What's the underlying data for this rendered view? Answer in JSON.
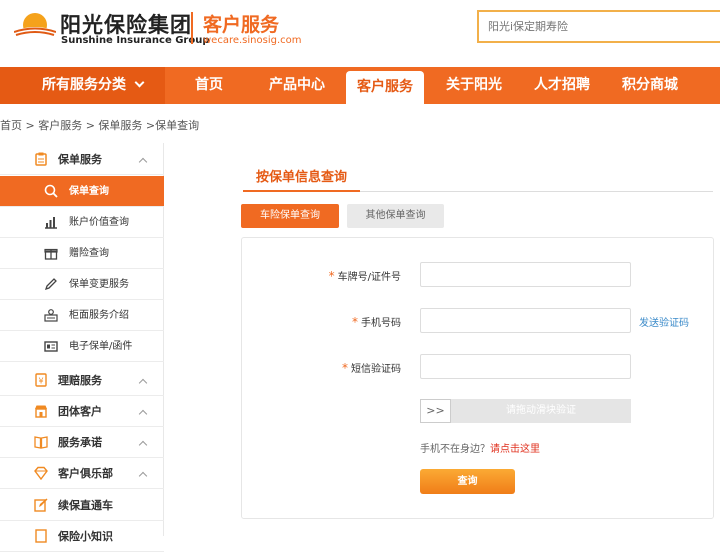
{
  "header": {
    "brand_cn": "阳光保险集团",
    "brand_en": "Sunshine Insurance Group",
    "section_title": "客户服务",
    "section_url": "wecare.sinosig.com",
    "search_placeholder": "阳光i保定期寿险"
  },
  "nav": {
    "all_services": "所有服务分类",
    "items": [
      {
        "label": "首页"
      },
      {
        "label": "产品中心"
      },
      {
        "label": "客户服务"
      },
      {
        "label": "关于阳光"
      },
      {
        "label": "人才招聘"
      },
      {
        "label": "积分商城"
      }
    ],
    "active_index": 2
  },
  "breadcrumb": "首页 > 客户服务 > 保单服务 >保单查询",
  "sidebar": {
    "items": [
      {
        "label": "保单服务",
        "icon": "clipboard-icon"
      },
      {
        "label": "保单查询",
        "icon": "search-icon"
      },
      {
        "label": "账户价值查询",
        "icon": "bar-chart-icon"
      },
      {
        "label": "赠险查询",
        "icon": "gift-icon"
      },
      {
        "label": "保单变更服务",
        "icon": "pencil-icon"
      },
      {
        "label": "柜面服务介绍",
        "icon": "counter-icon"
      },
      {
        "label": "电子保单/函件",
        "icon": "id-card-icon"
      },
      {
        "label": "理赔服务",
        "icon": "claim-icon"
      },
      {
        "label": "团体客户",
        "icon": "store-icon"
      },
      {
        "label": "服务承诺",
        "icon": "book-icon"
      },
      {
        "label": "客户俱乐部",
        "icon": "diamond-icon"
      },
      {
        "label": "续保直通车",
        "icon": "edit-icon"
      },
      {
        "label": "保险小知识",
        "icon": "doc-icon"
      }
    ]
  },
  "main": {
    "tab_title": "按保单信息查询",
    "sub_tabs": [
      "车险保单查询",
      "其他保单查询"
    ],
    "form": {
      "plate_label": "车牌号/证件号",
      "phone_label": "手机号码",
      "sms_label": "短信验证码",
      "send_code": "发送验证码",
      "slider_handle": ">>",
      "slider_text": "请拖动滑块验证",
      "hint_text": "手机不在身边？",
      "hint_link": "请点击这里",
      "query_button": "查询"
    }
  },
  "colors": {
    "brand_orange": "#f06a22",
    "link_blue": "#3a8ac9",
    "hint_red": "#e0301e"
  }
}
